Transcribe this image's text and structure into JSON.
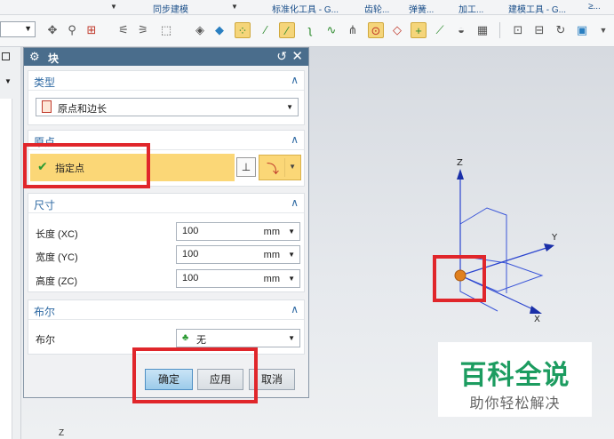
{
  "menubar": {
    "items": [
      "同步建模",
      "标准化工具 - G...",
      "齿轮...",
      "弹簧...",
      "加工...",
      "建模工具 - G...",
      "≥..."
    ]
  },
  "dialog": {
    "title": "块",
    "sections": {
      "type": {
        "label": "类型",
        "value": "原点和边长"
      },
      "origin": {
        "label": "原点",
        "specify_point": "指定点"
      },
      "dimensions": {
        "label": "尺寸",
        "rows": [
          {
            "label": "长度 (XC)",
            "value": "100",
            "unit": "mm"
          },
          {
            "label": "宽度 (YC)",
            "value": "100",
            "unit": "mm"
          },
          {
            "label": "高度 (ZC)",
            "value": "100",
            "unit": "mm"
          }
        ]
      },
      "boolean": {
        "label": "布尔",
        "row_label": "布尔",
        "value": "无"
      }
    },
    "buttons": {
      "ok": "确定",
      "apply": "应用",
      "cancel": "取消"
    }
  },
  "view": {
    "axis_z": "Z",
    "axis_y": "Y",
    "axis_x": "X",
    "bottom_axis": "Z"
  },
  "watermark": {
    "title": "百科全说",
    "subtitle": "助你轻松解决"
  },
  "colors": {
    "title_bar": "#4a6d8c",
    "section_label": "#2f6aa3",
    "highlight": "#e0262b",
    "selected_row": "#fbd777",
    "watermark_green": "#1c9c60"
  }
}
